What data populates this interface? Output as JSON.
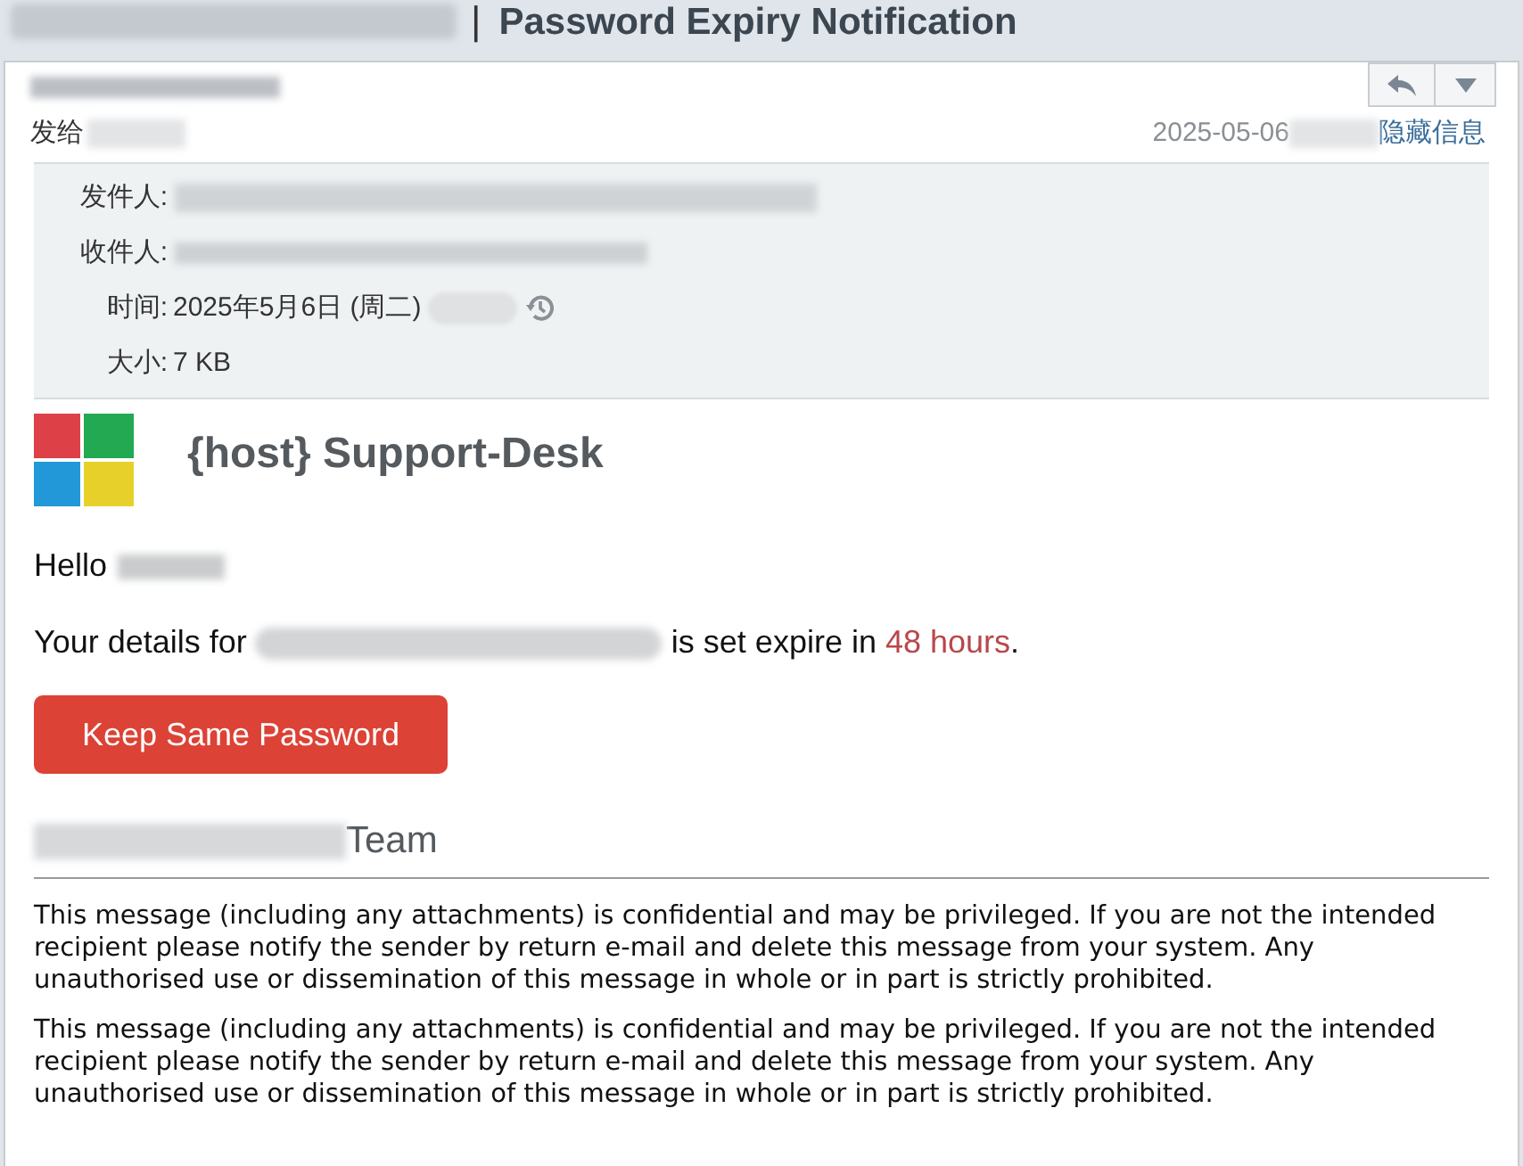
{
  "title_separator": "|",
  "subject": "Password Expiry Notification",
  "header": {
    "to_label": "发给",
    "date": "2025-05-06",
    "hide_details_link": "隐藏信息"
  },
  "details": [
    {
      "label": "发件人:"
    },
    {
      "label": "收件人:"
    },
    {
      "label": "时间:",
      "value": "2025年5月6日 (周二)"
    },
    {
      "label": "大小:",
      "value": "7 KB"
    }
  ],
  "brand": {
    "name": "{host} Support-Desk"
  },
  "greeting": "Hello",
  "message": {
    "before": "Your details for",
    "after": "is set expire in",
    "highlight": "48 hours",
    "end": "."
  },
  "button": "Keep Same Password",
  "signature": "Team",
  "disclaimers": [
    "This message (including any attachments) is confidential and may be privileged. If you are not the intended recipient please notify the sender by return e-mail and delete this message from your system. Any unauthorised use or dissemination of this message in whole or in part is strictly prohibited.",
    "This message (including any attachments) is confidential and may be privileged. If you are not the intended recipient please notify the sender by return e-mail and delete this message from your system. Any unauthorised use or dissemination of this message in whole or in part is strictly prohibited."
  ]
}
